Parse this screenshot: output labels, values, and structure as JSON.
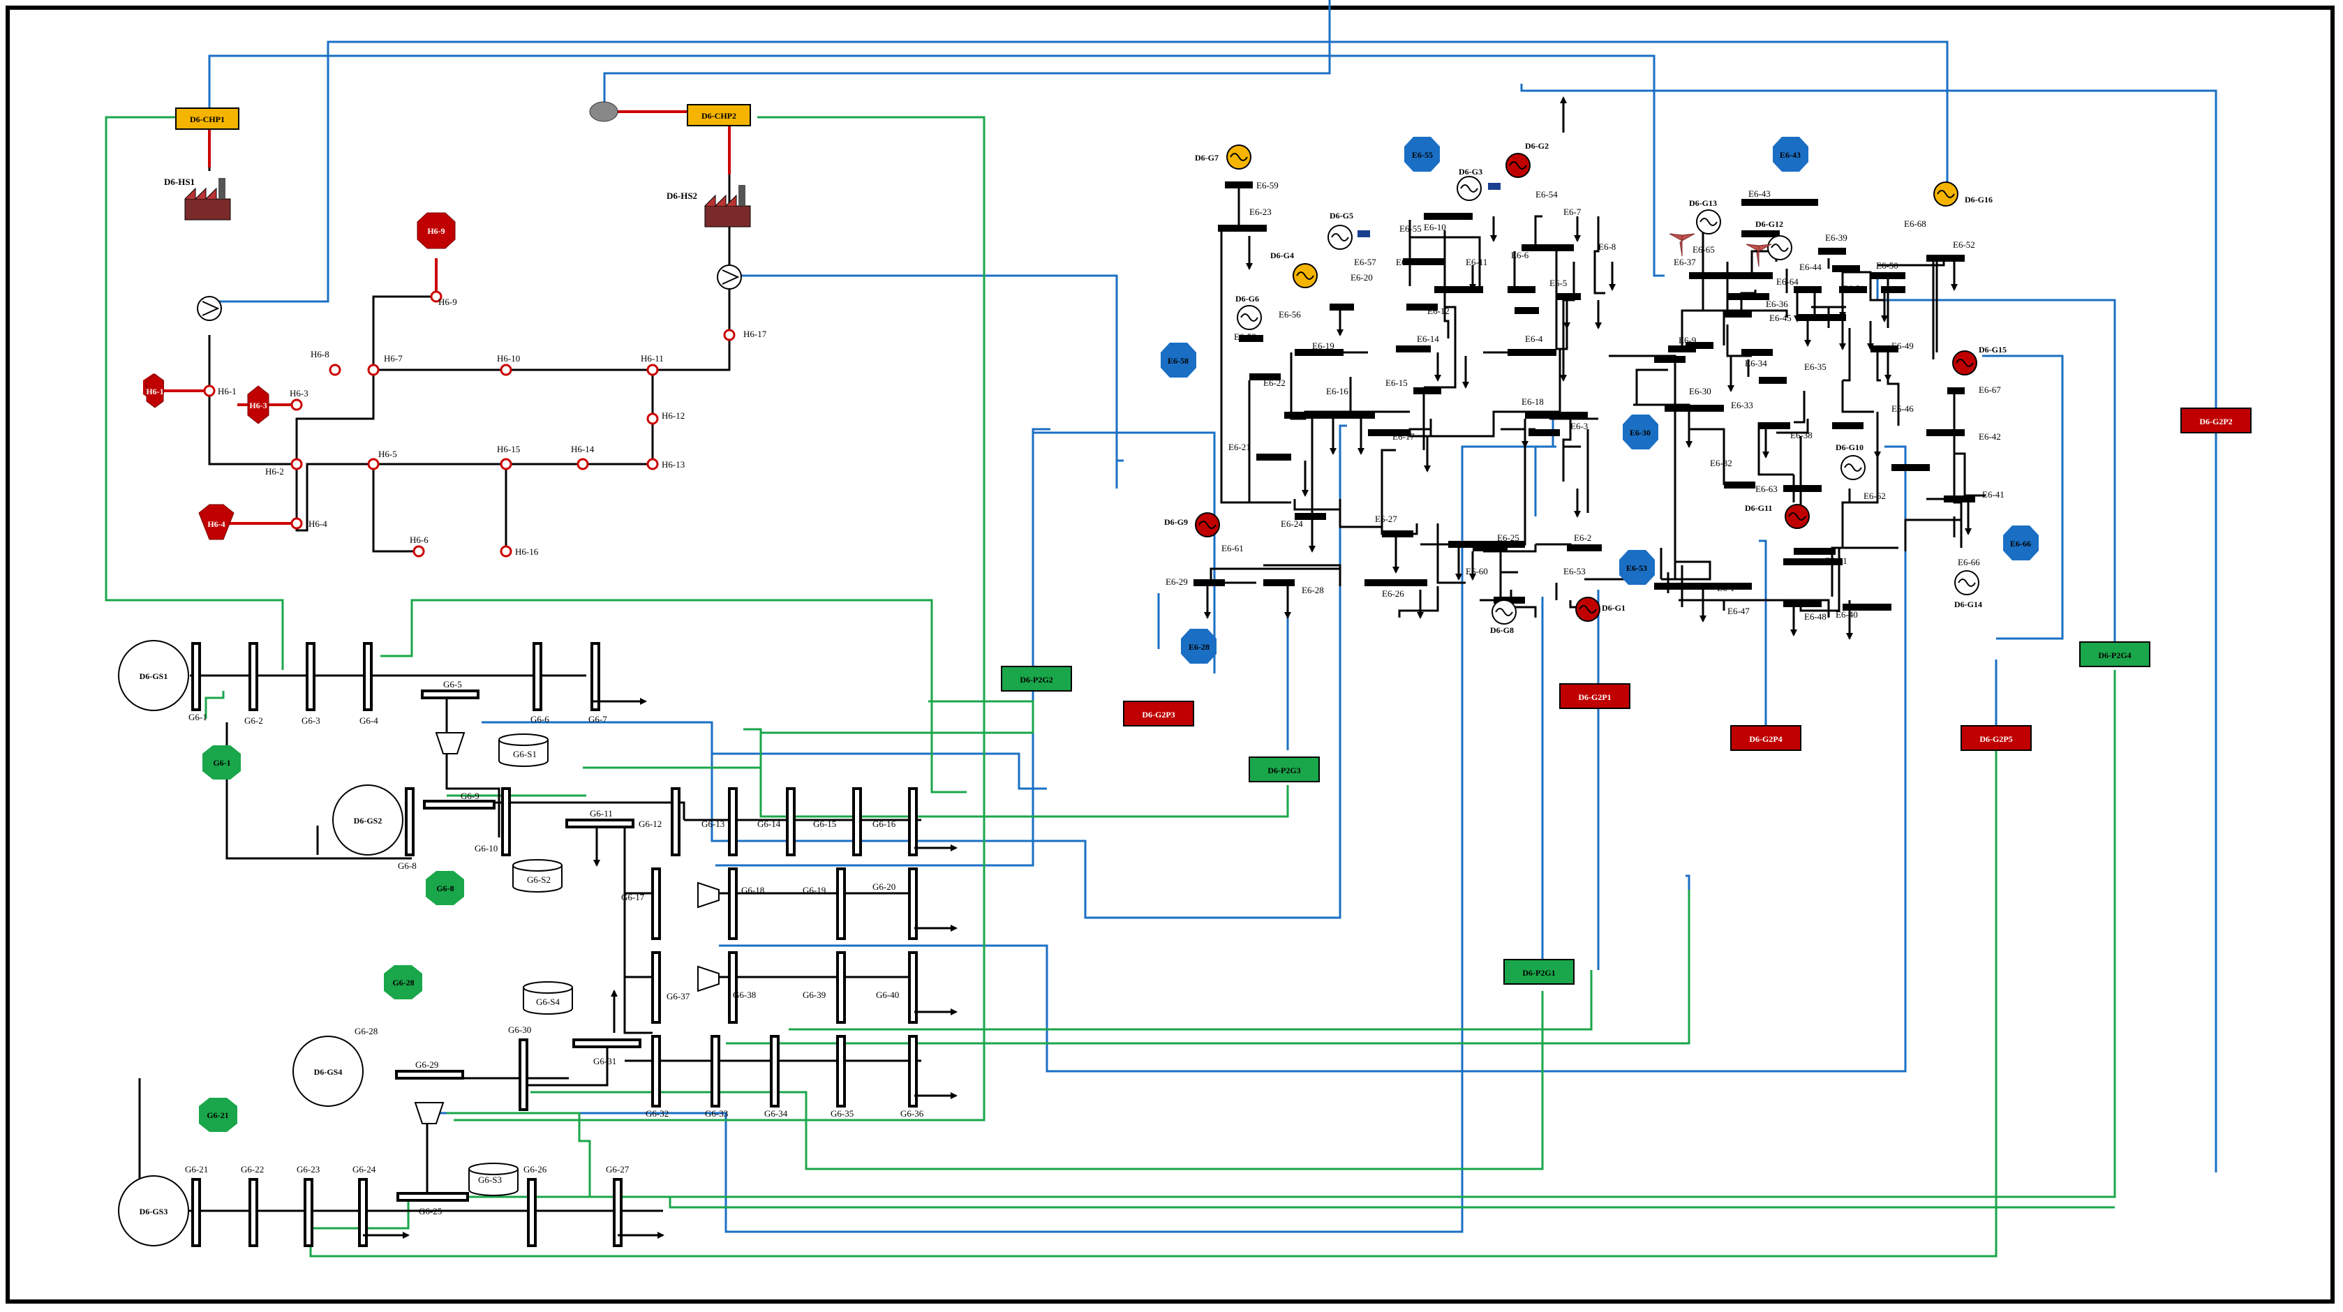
{
  "colors": {
    "heat_pipe": "#cc0000",
    "gas_link": "#1aa64a",
    "power_link": "#1a6fc4",
    "chp_fill": "#f5b400",
    "gen_red": "#c00000",
    "gen_yellow": "#f5b400",
    "load_blue": "#1a6fc4",
    "gas_load_green": "#1aa64a",
    "heat_load_red": "#c00000",
    "conv_green": "#1aa64a",
    "conv_red": "#c00000",
    "bus": "#000000"
  },
  "heat_network": {
    "chp_units": [
      {
        "label": "D6-CHP1"
      },
      {
        "label": "D6-CHP2"
      }
    ],
    "heat_sources": [
      {
        "label": "D6-HS1"
      },
      {
        "label": "D6-HS2"
      }
    ],
    "nodes": [
      "H6-1",
      "H6-2",
      "H6-3",
      "H6-4",
      "H6-5",
      "H6-6",
      "H6-7",
      "H6-8",
      "H6-9",
      "H6-10",
      "H6-11",
      "H6-12",
      "H6-13",
      "H6-14",
      "H6-15",
      "H6-16",
      "H6-17"
    ],
    "heat_loads": [
      {
        "label": "H6-1"
      },
      {
        "label": "H6-3"
      },
      {
        "label": "H6-4"
      },
      {
        "label": "H6-9"
      }
    ]
  },
  "gas_network": {
    "sources": [
      {
        "label": "D6-GS1"
      },
      {
        "label": "D6-GS2"
      },
      {
        "label": "D6-GS3"
      },
      {
        "label": "D6-GS4"
      }
    ],
    "storages": [
      "G6-S1",
      "G6-S2",
      "G6-S3",
      "G6-S4"
    ],
    "nodes": [
      "G6-1",
      "G6-2",
      "G6-3",
      "G6-4",
      "G6-5",
      "G6-6",
      "G6-7",
      "G6-8",
      "G6-9",
      "G6-10",
      "G6-11",
      "G6-12",
      "G6-13",
      "G6-14",
      "G6-15",
      "G6-16",
      "G6-17",
      "G6-18",
      "G6-19",
      "G6-20",
      "G6-21",
      "G6-22",
      "G6-23",
      "G6-24",
      "G6-25",
      "G6-26",
      "G6-27",
      "G6-28",
      "G6-29",
      "G6-30",
      "G6-31",
      "G6-32",
      "G6-33",
      "G6-34",
      "G6-35",
      "G6-36",
      "G6-37",
      "G6-38",
      "G6-39",
      "G6-40"
    ],
    "gas_loads": [
      {
        "label": "G6-1"
      },
      {
        "label": "G6-8"
      },
      {
        "label": "G6-21"
      },
      {
        "label": "G6-28"
      }
    ]
  },
  "converters": {
    "p2g": [
      {
        "label": "D6-P2G1"
      },
      {
        "label": "D6-P2G2"
      },
      {
        "label": "D6-P2G3"
      },
      {
        "label": "D6-P2G4"
      }
    ],
    "g2p": [
      {
        "label": "D6-G2P1"
      },
      {
        "label": "D6-G2P2"
      },
      {
        "label": "D6-G2P3"
      },
      {
        "label": "D6-G2P4"
      },
      {
        "label": "D6-G2P5"
      }
    ]
  },
  "power_network": {
    "generators": [
      {
        "label": "D6-G1",
        "type": "red"
      },
      {
        "label": "D6-G2",
        "type": "red"
      },
      {
        "label": "D6-G3",
        "type": "plain"
      },
      {
        "label": "D6-G4",
        "type": "yellow"
      },
      {
        "label": "D6-G5",
        "type": "plain"
      },
      {
        "label": "D6-G6",
        "type": "plain"
      },
      {
        "label": "D6-G7",
        "type": "yellow"
      },
      {
        "label": "D6-G8",
        "type": "plain"
      },
      {
        "label": "D6-G9",
        "type": "red"
      },
      {
        "label": "D6-G10",
        "type": "plain"
      },
      {
        "label": "D6-G11",
        "type": "red"
      },
      {
        "label": "D6-G12",
        "type": "plain"
      },
      {
        "label": "D6-G13",
        "type": "plain"
      },
      {
        "label": "D6-G14",
        "type": "plain"
      },
      {
        "label": "D6-G15",
        "type": "red"
      },
      {
        "label": "D6-G16",
        "type": "yellow"
      }
    ],
    "buses": [
      "E6-1",
      "E6-2",
      "E6-3",
      "E6-4",
      "E6-5",
      "E6-6",
      "E6-7",
      "E6-8",
      "E6-9",
      "E6-10",
      "E6-11",
      "E6-12",
      "E6-13",
      "E6-14",
      "E6-15",
      "E6-16",
      "E6-17",
      "E6-18",
      "E6-19",
      "E6-20",
      "E6-21",
      "E6-22",
      "E6-23",
      "E6-24",
      "E6-25",
      "E6-26",
      "E6-27",
      "E6-28",
      "E6-29",
      "E6-30",
      "E6-31",
      "E6-32",
      "E6-33",
      "E6-34",
      "E6-35",
      "E6-36",
      "E6-37",
      "E6-38",
      "E6-39",
      "E6-40",
      "E6-41",
      "E6-42",
      "E6-43",
      "E6-44",
      "E6-45",
      "E6-46",
      "E6-47",
      "E6-48",
      "E6-49",
      "E6-50",
      "E6-51",
      "E6-52",
      "E6-53",
      "E6-54",
      "E6-55",
      "E6-56",
      "E6-57",
      "E6-58",
      "E6-59",
      "E6-60",
      "E6-61",
      "E6-62",
      "E6-63",
      "E6-64",
      "E6-65",
      "E6-66",
      "E6-67",
      "E6-68"
    ],
    "power_loads": [
      {
        "label": "E6-55"
      },
      {
        "label": "E6-43"
      },
      {
        "label": "E6-58"
      },
      {
        "label": "E6-30"
      },
      {
        "label": "E6-53"
      },
      {
        "label": "E6-28"
      },
      {
        "label": "E6-66"
      }
    ]
  }
}
